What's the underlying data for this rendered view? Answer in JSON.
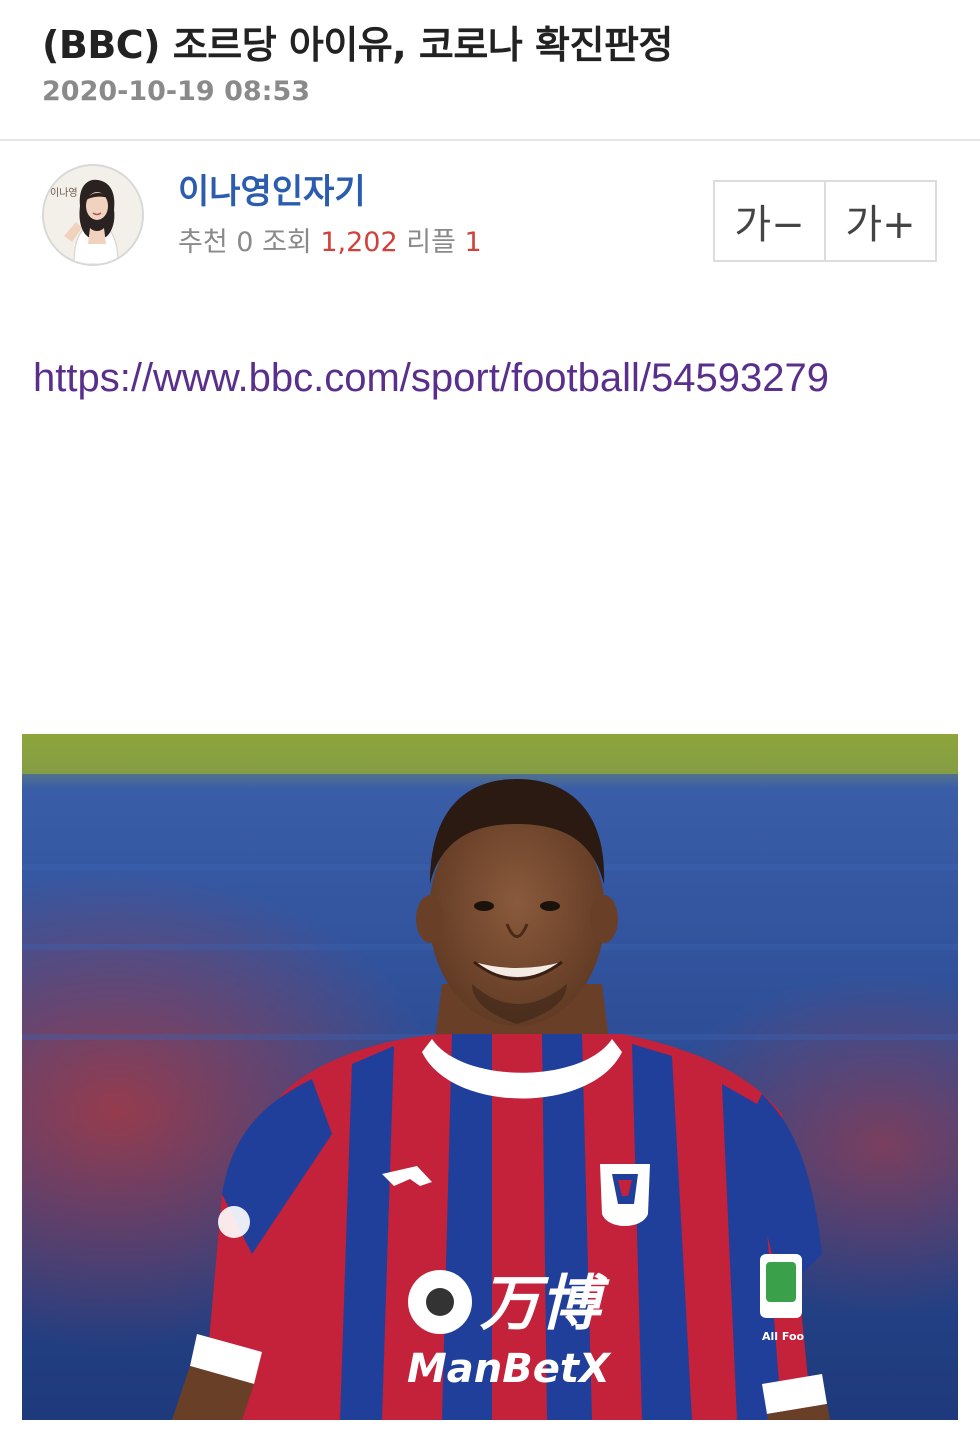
{
  "post": {
    "title": "(BBC) 조르당 아이유, 코로나 확진판정",
    "date": "2020-10-19 08:53"
  },
  "author": {
    "name": "이나영인자기",
    "avatar_caption": "이나영"
  },
  "stats": {
    "recommend_label": "추천",
    "recommend_count": "0",
    "views_label": "조회",
    "views_count": "1,202",
    "replies_label": "리플",
    "replies_count": "1"
  },
  "font_controls": {
    "decrease_label": "가−",
    "increase_label": "가+"
  },
  "content": {
    "link_text": "https://www.bbc.com/sport/football/54593279"
  },
  "photo": {
    "sponsor_chinese": "万博",
    "sponsor_latin": "ManBetX",
    "sleeve_patch_text": "All Foo",
    "colors": {
      "stand_blue": "#2b4a8f",
      "shirt_red": "#c4213a",
      "shirt_blue": "#1f3f9a",
      "skin": "#7a4b32"
    }
  }
}
